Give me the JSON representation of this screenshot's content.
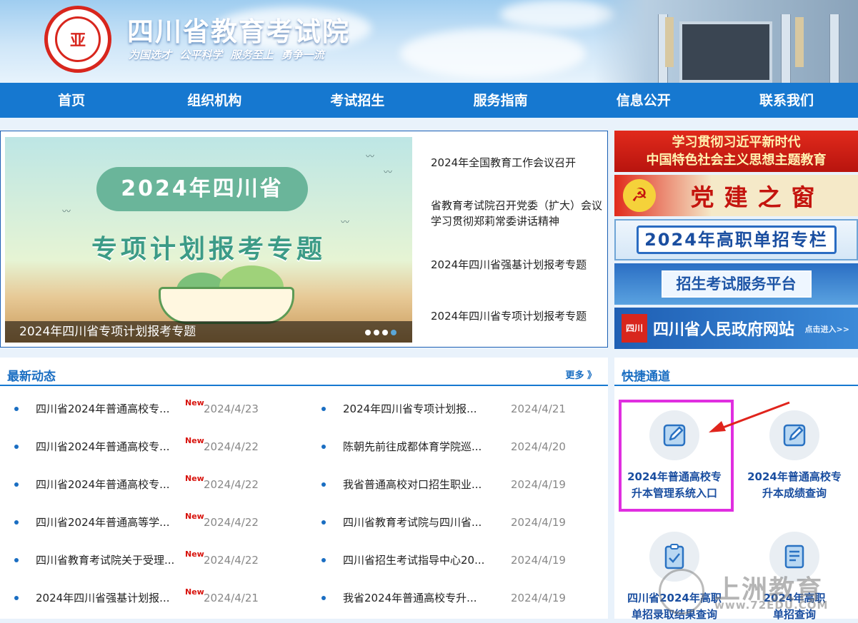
{
  "header": {
    "title": "四川省教育考试院",
    "slogan": "为国选才  公平科学  服务至上  勇争一流",
    "logo_char": "亚"
  },
  "nav": [
    "首页",
    "组织机构",
    "考试招生",
    "服务指南",
    "信息公开",
    "联系我们"
  ],
  "banner": {
    "pill_text": "2024年四川省",
    "subtitle": "专项计划报考专题",
    "caption": "2024年四川省专项计划报考专题"
  },
  "headlines": [
    "2024年全国教育工作会议召开",
    "省教育考试院召开党委（扩大）会议学习贯彻郑莉常委讲话精神",
    "2024年四川省强基计划报考专题",
    "2024年四川省专项计划报考专题"
  ],
  "right_banners": {
    "theme_line1": "学习贯彻习近平新时代",
    "theme_line2": "中国特色社会主义思想主题教育",
    "party": "党建之窗",
    "party_emblem": "☭",
    "gaozhi": "2024年高职单招专栏",
    "platform": "招生考试服务平台",
    "gov": "四川省人民政府网站",
    "gov_emblem": "四川",
    "gov_enter": "点击进入>>"
  },
  "latest": {
    "title": "最新动态",
    "more": "更多 》",
    "new_tag": "New",
    "left": [
      {
        "title": "四川省2024年普通高校专...",
        "date": "2024/4/23"
      },
      {
        "title": "四川省2024年普通高校专...",
        "date": "2024/4/22"
      },
      {
        "title": "四川省2024年普通高校专...",
        "date": "2024/4/22"
      },
      {
        "title": "四川省2024年普通高等学...",
        "date": "2024/4/22"
      },
      {
        "title": "四川省教育考试院关于受理...",
        "date": "2024/4/22"
      },
      {
        "title": "2024年四川省强基计划报...",
        "date": "2024/4/21"
      }
    ],
    "right": [
      {
        "title": "2024年四川省专项计划报...",
        "date": "2024/4/21"
      },
      {
        "title": "陈朝先前往成都体育学院巡...",
        "date": "2024/4/20"
      },
      {
        "title": "我省普通高校对口招生职业...",
        "date": "2024/4/19"
      },
      {
        "title": "四川省教育考试院与四川省...",
        "date": "2024/4/19"
      },
      {
        "title": "四川省招生考试指导中心20...",
        "date": "2024/4/19"
      },
      {
        "title": "我省2024年普通高校专升...",
        "date": "2024/4/19"
      }
    ]
  },
  "quick": {
    "title": "快捷通道",
    "items": [
      {
        "line1": "2024年普通高校专",
        "line2": "升本管理系统入口"
      },
      {
        "line1": "2024年普通高校专",
        "line2": "升本成绩查询"
      },
      {
        "line1": "四川省2024年高职",
        "line2": "单招录取结果查询"
      },
      {
        "line1": "2024年高职",
        "line2": "单招查询"
      }
    ]
  },
  "watermark": {
    "text": "上洲教育",
    "url": "www.72EDU.COM"
  }
}
